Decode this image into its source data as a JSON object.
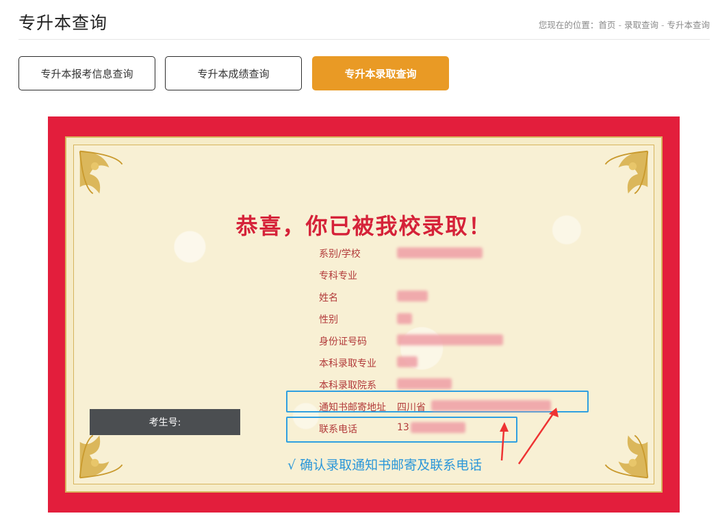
{
  "header": {
    "title": "专升本查询",
    "breadcrumb_prefix": "您现在的位置：",
    "breadcrumb": [
      "首页",
      "录取查询",
      "专升本查询"
    ]
  },
  "tabs": [
    {
      "label": "专升本报考信息查询",
      "active": false
    },
    {
      "label": "专升本成绩查询",
      "active": false
    },
    {
      "label": "专升本录取查询",
      "active": true
    }
  ],
  "certificate": {
    "headline": "恭喜，你已被我校录取！",
    "fields": [
      {
        "label": "系别/学校",
        "value": ""
      },
      {
        "label": "专科专业",
        "value": ""
      },
      {
        "label": "姓名",
        "value": ""
      },
      {
        "label": "性别",
        "value": ""
      },
      {
        "label": "身份证号码",
        "value": ""
      },
      {
        "label": "本科录取专业",
        "value": ""
      },
      {
        "label": "本科录取院系",
        "value": ""
      },
      {
        "label": "通知书邮寄地址",
        "value": "四川省"
      },
      {
        "label": "联系电话",
        "value": "13"
      }
    ],
    "exam_number_label": "考生号:",
    "confirm_note": "√  确认录取通知书邮寄及联系电话"
  },
  "colors": {
    "brand_orange": "#e99a25",
    "certificate_red": "#e31e3c",
    "highlight_blue": "#2e9fe0",
    "headline_red": "#d52239"
  }
}
